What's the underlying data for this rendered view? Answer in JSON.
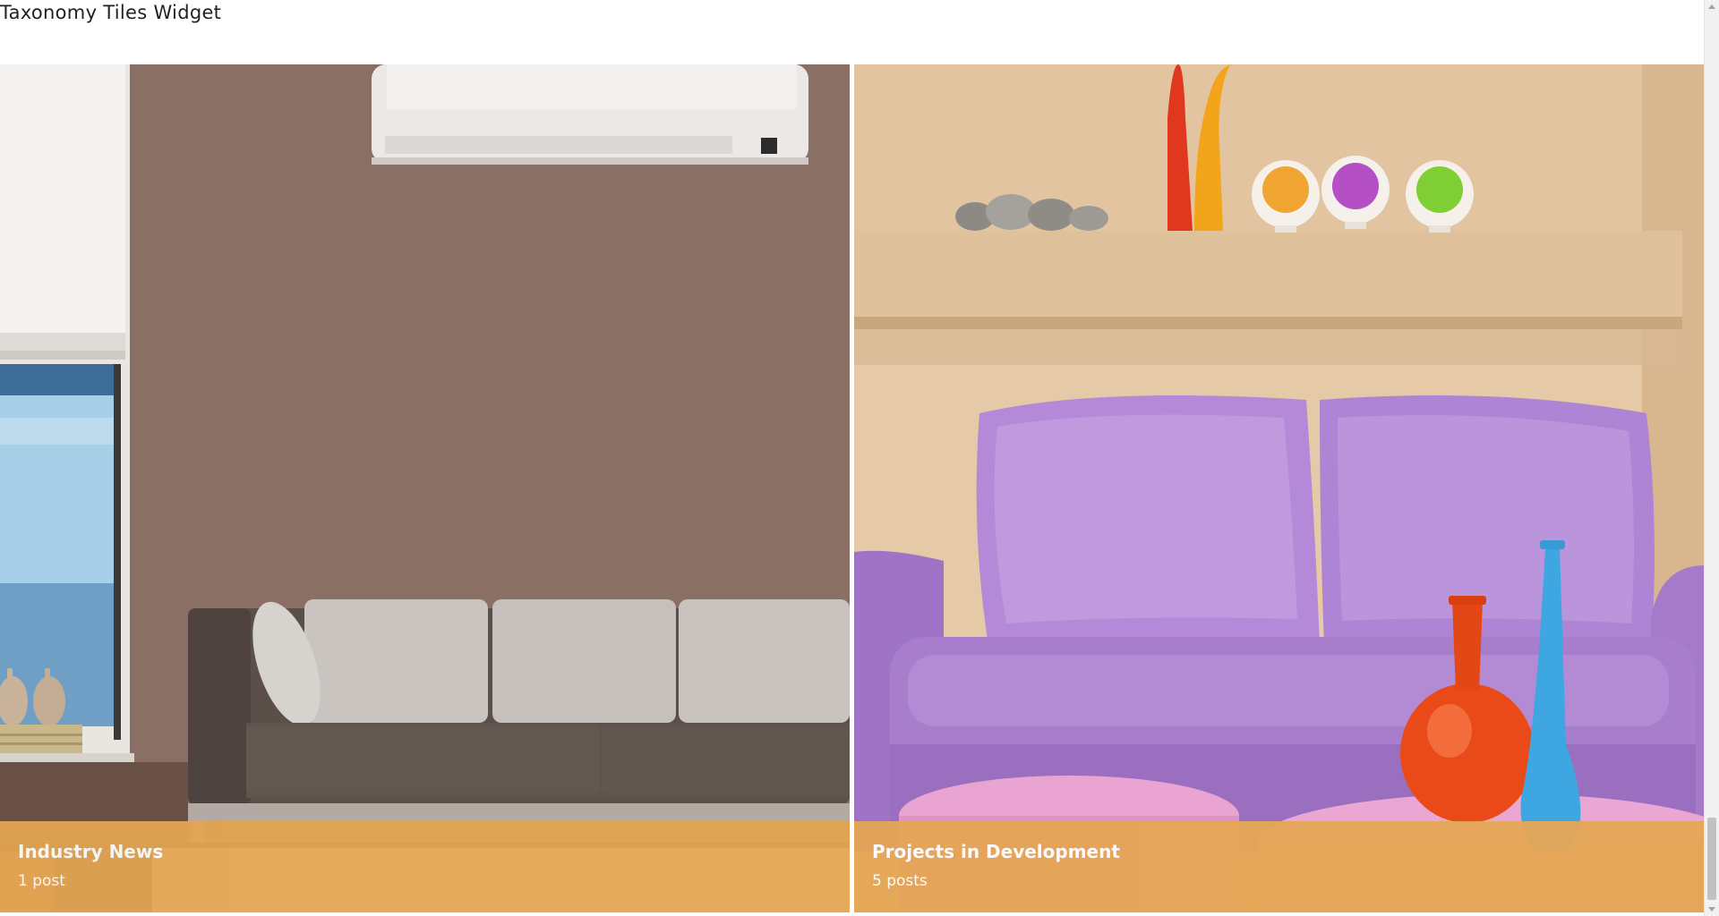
{
  "widget": {
    "title": "Taxonomy Tiles Widget"
  },
  "tiles": [
    {
      "name": "Industry News",
      "count": "1 post",
      "caption_color": "#e5a654"
    },
    {
      "name": "Projects in Development",
      "count": "5 posts",
      "caption_color": "#e5a654"
    }
  ],
  "icons": {
    "scroll_up": "scroll-up-arrow-icon",
    "scroll_down": "scroll-down-arrow-icon"
  }
}
